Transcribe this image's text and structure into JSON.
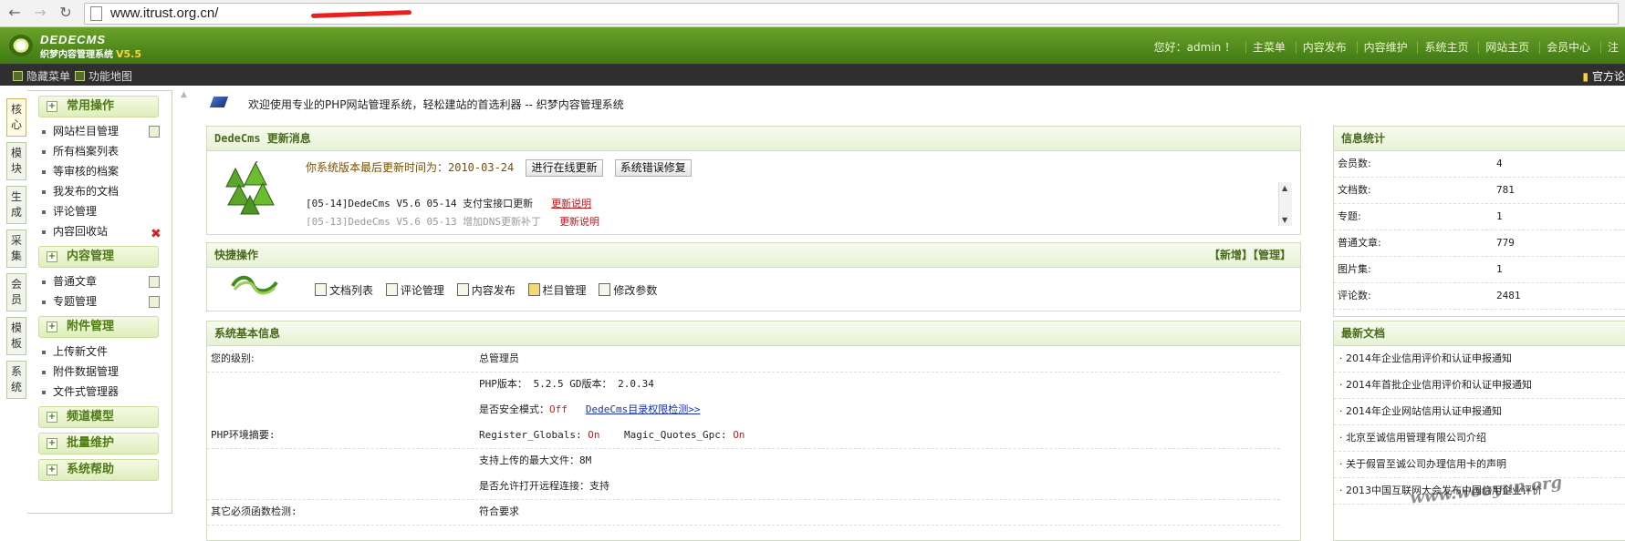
{
  "browser": {
    "back_icon": "back-arrow-icon",
    "forward_icon": "forward-arrow-icon",
    "reload_icon": "reload-icon",
    "url": "www.itrust.org.cn/"
  },
  "header": {
    "logo_title": "DEDECMS",
    "logo_subtitle": "织梦内容管理系统",
    "logo_version": "V5.5",
    "greeting": "您好：admin ！",
    "nav": [
      "主菜单",
      "内容发布",
      "内容维护",
      "系统主页",
      "网站主页",
      "会员中心"
    ]
  },
  "subbar": {
    "hide_menu": "隐藏菜单",
    "site_map": "功能地图",
    "official": "官方论"
  },
  "vtabs": [
    "核心",
    "模块",
    "生成",
    "采集",
    "会员",
    "模板",
    "系统"
  ],
  "menu": {
    "groups": [
      {
        "title": "常用操作",
        "items": [
          "网站栏目管理",
          "所有档案列表",
          "等审核的档案",
          "我发布的文档",
          "评论管理",
          "内容回收站"
        ]
      },
      {
        "title": "内容管理",
        "items": [
          "普通文章",
          "专题管理"
        ]
      },
      {
        "title": "附件管理",
        "items": [
          "上传新文件",
          "附件数据管理",
          "文件式管理器"
        ]
      },
      {
        "title": "频道模型",
        "items": []
      },
      {
        "title": "批量维护",
        "items": []
      },
      {
        "title": "系统帮助",
        "items": []
      }
    ]
  },
  "welcome": "欢迎使用专业的PHP网站管理系统，轻松建站的首选利器 -- 织梦内容管理系统",
  "update_panel": {
    "title": "DedeCms 更新消息",
    "notice": "你系统版本最后更新时间为：2010-03-24",
    "btn_online": "进行在线更新",
    "btn_fix": "系统错误修复",
    "news": [
      {
        "text": "[05-14]DedeCms V5.6 05-14 支付宝接口更新",
        "link": "更新说明"
      },
      {
        "text": "[05-13]DedeCms V5.6 05-13 增加DNS更新补丁",
        "link": "更新说明"
      }
    ]
  },
  "quick_panel": {
    "title": "快捷操作",
    "add": "【新增】",
    "manage": "【管理】",
    "links": [
      "文档列表",
      "评论管理",
      "内容发布",
      "栏目管理",
      "修改参数"
    ]
  },
  "sys_panel": {
    "title": "系统基本信息",
    "level_label": "您的级别:",
    "level_value": "总管理员",
    "env_label": "PHP环境摘要:",
    "php_version": "PHP版本： 5.2.5   GD版本： 2.0.34",
    "safe_mode_label": "是否安全模式：",
    "safe_mode_value": "Off",
    "perm_link": "DedeCms目录权限检测>>",
    "register_globals_label": "Register_Globals:",
    "register_globals_value": "On",
    "magic_quotes_label": "Magic_Quotes_Gpc:",
    "magic_quotes_value": "On",
    "max_upload": "支持上传的最大文件：8M",
    "remote_open": "是否允许打开远程连接：支持",
    "other_label": "其它必须函数检测:",
    "other_value": "符合要求"
  },
  "stats_panel": {
    "title": "信息统计",
    "rows": [
      {
        "k": "会员数:",
        "v": "4"
      },
      {
        "k": "文档数:",
        "v": "781"
      },
      {
        "k": "专题:",
        "v": "1"
      },
      {
        "k": "普通文章:",
        "v": "779"
      },
      {
        "k": "图片集:",
        "v": "1"
      },
      {
        "k": "评论数:",
        "v": "2481"
      }
    ]
  },
  "latest_panel": {
    "title": "最新文档",
    "items": [
      "· 2014年企业信用评价和认证申报通知",
      "· 2014年首批企业信用评价和认证申报通知",
      "· 2014年企业网站信用认证申报通知",
      "· 北京至诚信用管理有限公司介绍",
      "· 关于假冒至诚公司办理信用卡的声明",
      "· 2013中国互联网大会发布中国信用企业评价"
    ]
  },
  "watermark": "www.wooyun.org",
  "colors": {
    "header_green": "#4f8a1a",
    "panel_head": "#4a6a20",
    "accent_red": "#c71d1d",
    "link_blue": "#1833b3"
  }
}
